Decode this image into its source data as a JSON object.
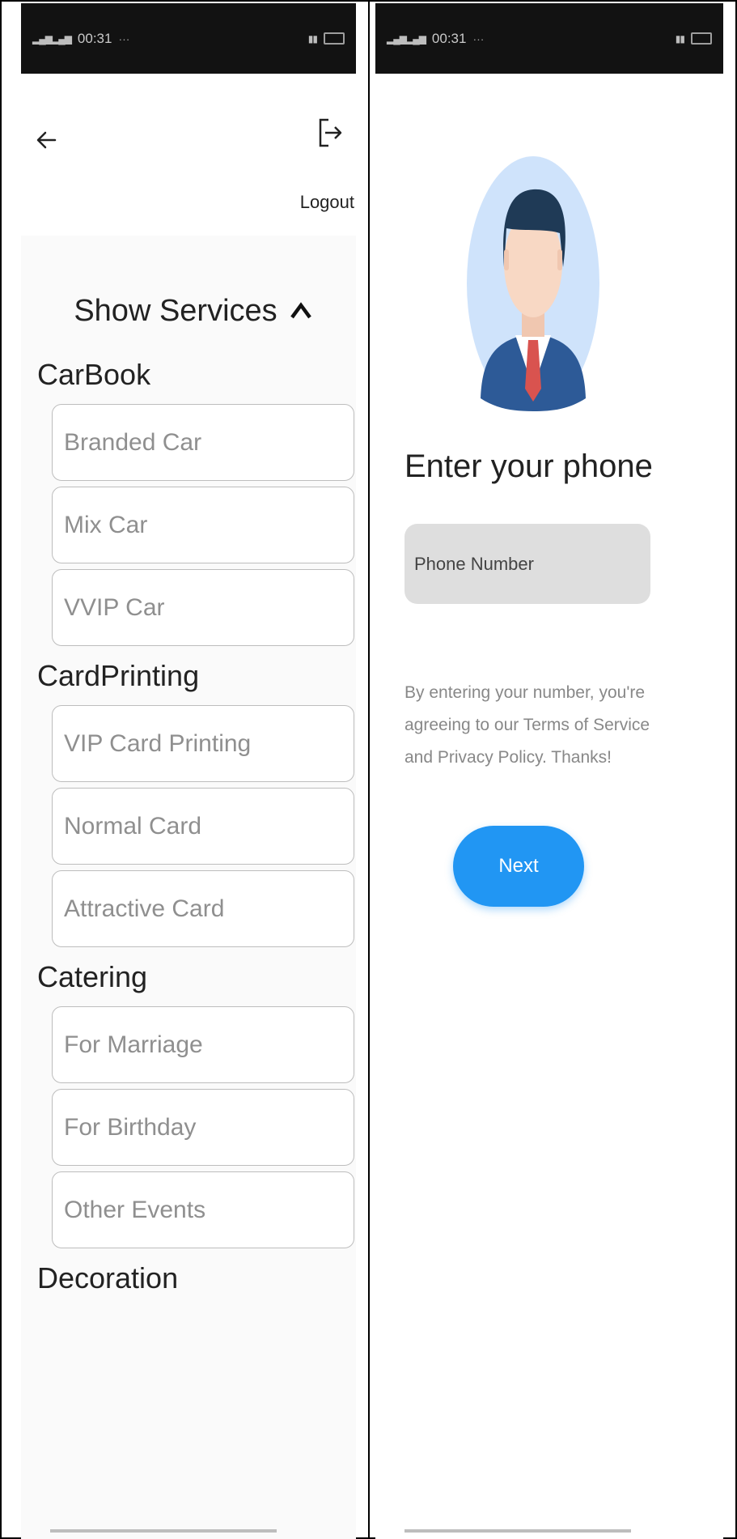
{
  "left_screen": {
    "status_bar": {
      "time": "00:31"
    },
    "header": {
      "logout_label": "Logout"
    },
    "show_services_label": "Show Services",
    "sections": [
      {
        "title": "CarBook",
        "fields": [
          "Branded Car",
          "Mix Car",
          "VVIP Car"
        ]
      },
      {
        "title": "CardPrinting",
        "fields": [
          "VIP Card Printing",
          "Normal Card",
          "Attractive Card"
        ]
      },
      {
        "title": "Catering",
        "fields": [
          "For Marriage",
          "For Birthday",
          "Other Events"
        ]
      },
      {
        "title": "Decoration",
        "fields": []
      }
    ]
  },
  "right_screen": {
    "status_bar": {
      "time": "00:31"
    },
    "headline": "Enter your phone",
    "phone_input": {
      "placeholder": "Phone Number"
    },
    "terms_text": "By entering your number, you're agreeing to our Terms of Service and Privacy Policy. Thanks!",
    "next_label": "Next"
  },
  "colors": {
    "primary_button": "#2196f3",
    "status_bar_bg": "#121212",
    "input_bg": "#dedede",
    "avatar_bg": "#cfe3fb",
    "suit": "#2d5a97",
    "tie": "#d9534f"
  },
  "icons": {
    "back": "arrow-left-icon",
    "logout": "logout-icon",
    "caret": "caret-up-icon",
    "avatar": "businessman-avatar-icon"
  }
}
